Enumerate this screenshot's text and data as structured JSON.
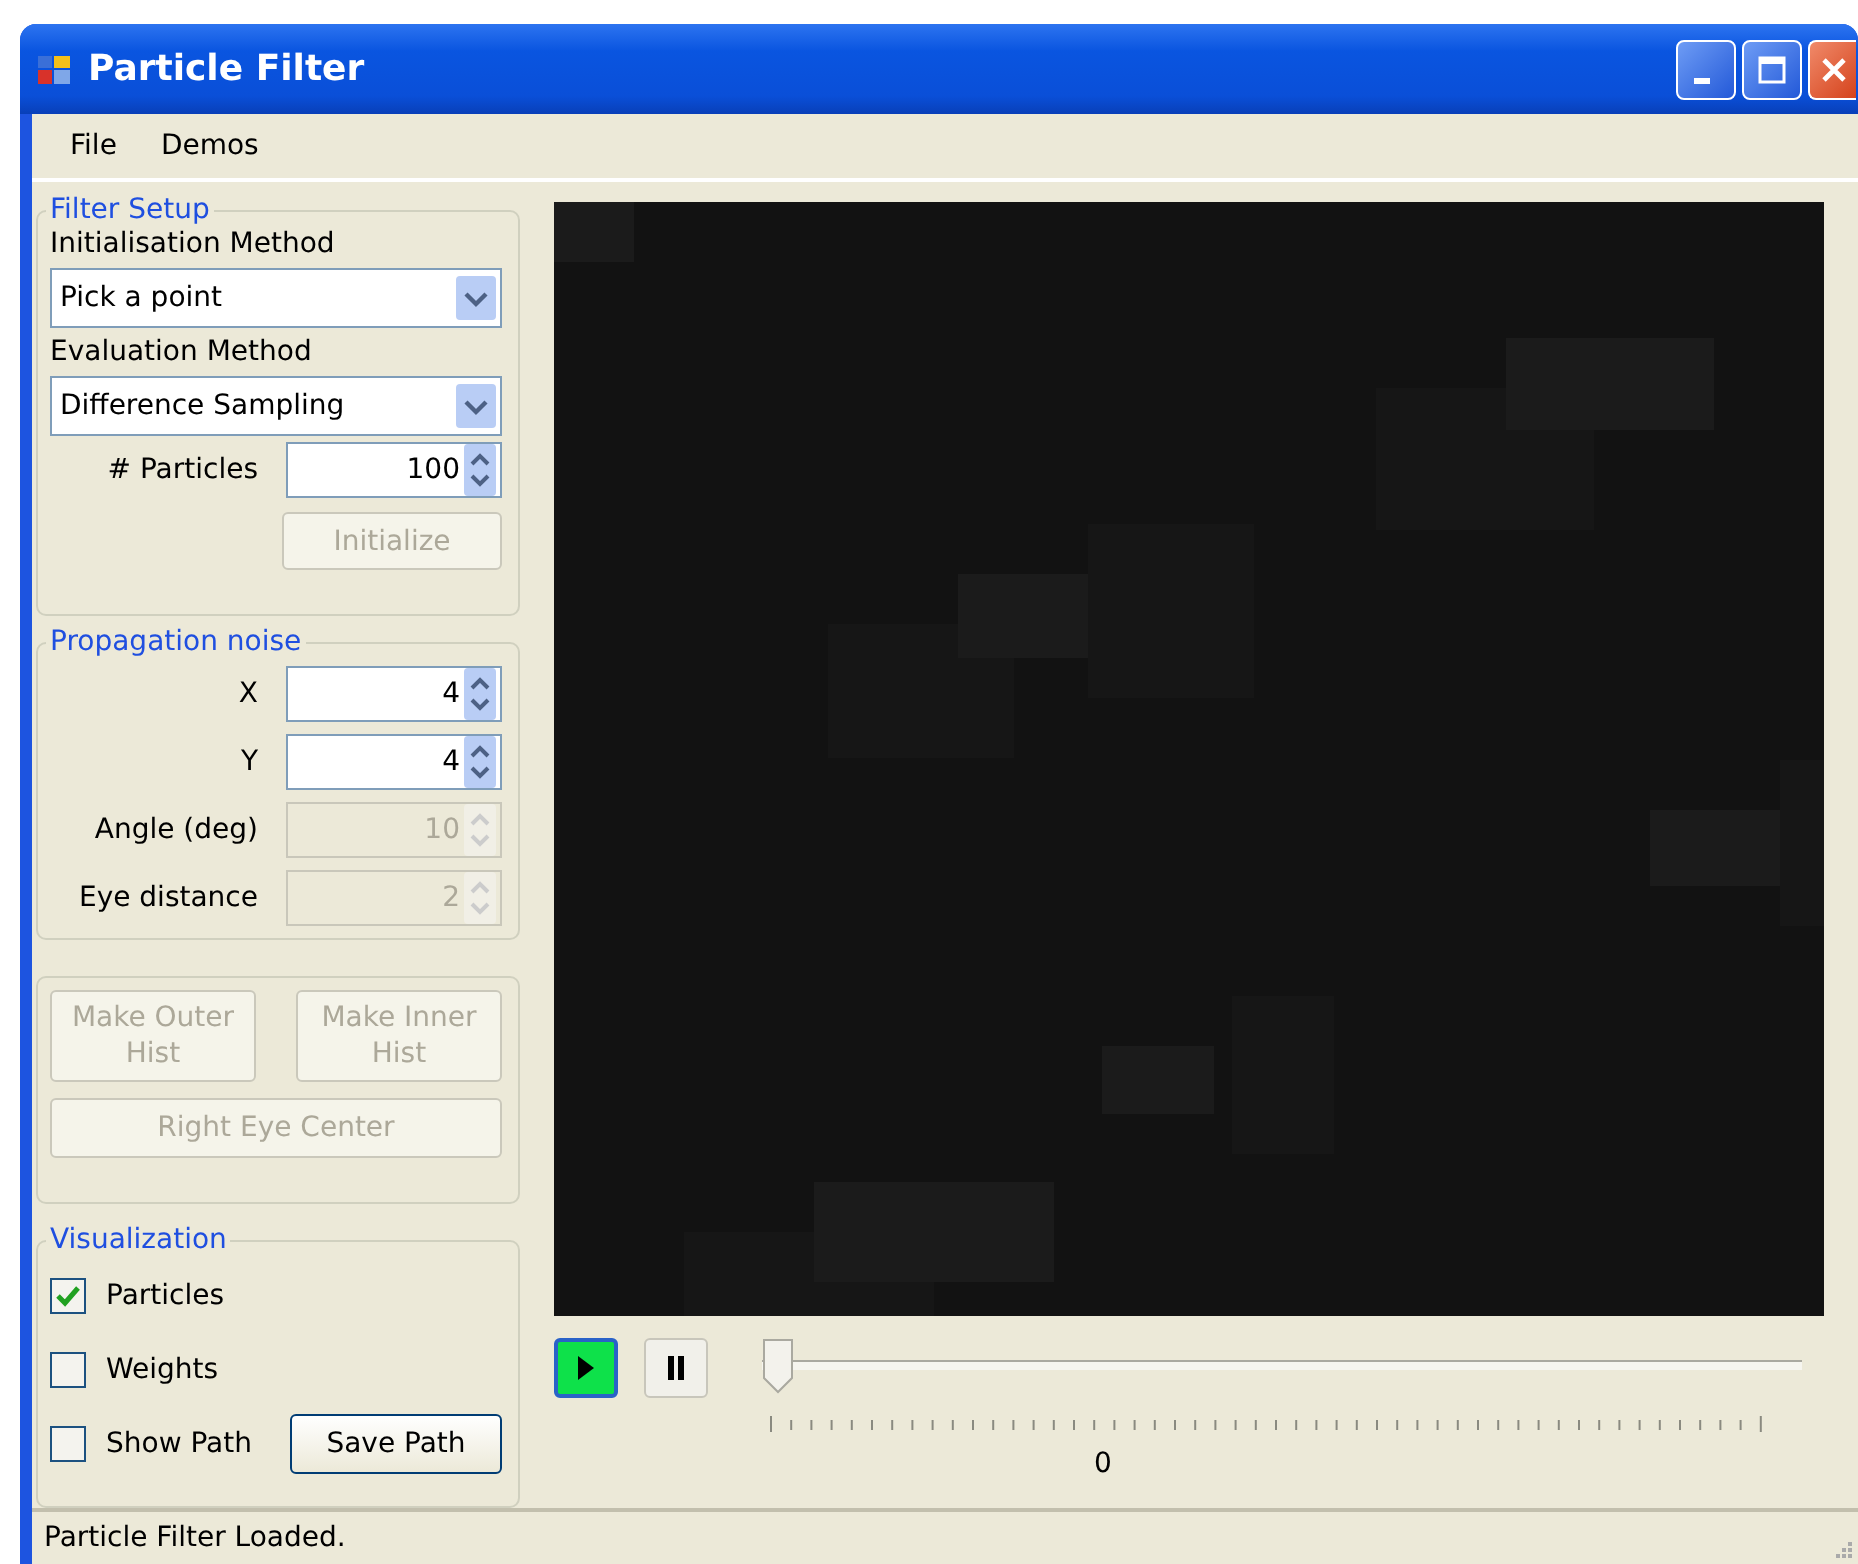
{
  "window": {
    "title": "Particle Filter"
  },
  "menu": [
    {
      "label": "File"
    },
    {
      "label": "Demos"
    }
  ],
  "filter_setup": {
    "title": "Filter Setup",
    "init_label": "Initialisation Method",
    "init_value": "Pick a point",
    "eval_label": "Evaluation Method",
    "eval_value": "Difference Sampling",
    "particles": {
      "label": "# Particles",
      "value": "100",
      "disabled": false
    },
    "initialize": {
      "label": "Initialize",
      "disabled": true
    }
  },
  "propagation_noise": {
    "title": "Propagation noise",
    "fields": [
      {
        "label": "X",
        "value": "4",
        "disabled": false
      },
      {
        "label": "Y",
        "value": "4",
        "disabled": false
      },
      {
        "label": "Angle (deg)",
        "value": "10",
        "disabled": true
      },
      {
        "label": "Eye distance",
        "value": "2",
        "disabled": true
      }
    ]
  },
  "hist_buttons": [
    {
      "label": "Make Outer Hist",
      "disabled": true
    },
    {
      "label": "Make Inner Hist",
      "disabled": true
    }
  ],
  "eye_button": {
    "label": "Right Eye Center",
    "disabled": true
  },
  "visualization": {
    "title": "Visualization",
    "options": [
      {
        "label": "Particles",
        "checked": true
      },
      {
        "label": "Weights",
        "checked": false
      },
      {
        "label": "Show Path",
        "checked": false
      }
    ],
    "save_button": {
      "label": "Save Path",
      "disabled": false
    }
  },
  "playback": {
    "play": {
      "selected": true
    },
    "pause": {
      "selected": false
    },
    "slider": {
      "level": 0
    },
    "reading": "0"
  },
  "status_bar": "Particle Filter Loaded."
}
